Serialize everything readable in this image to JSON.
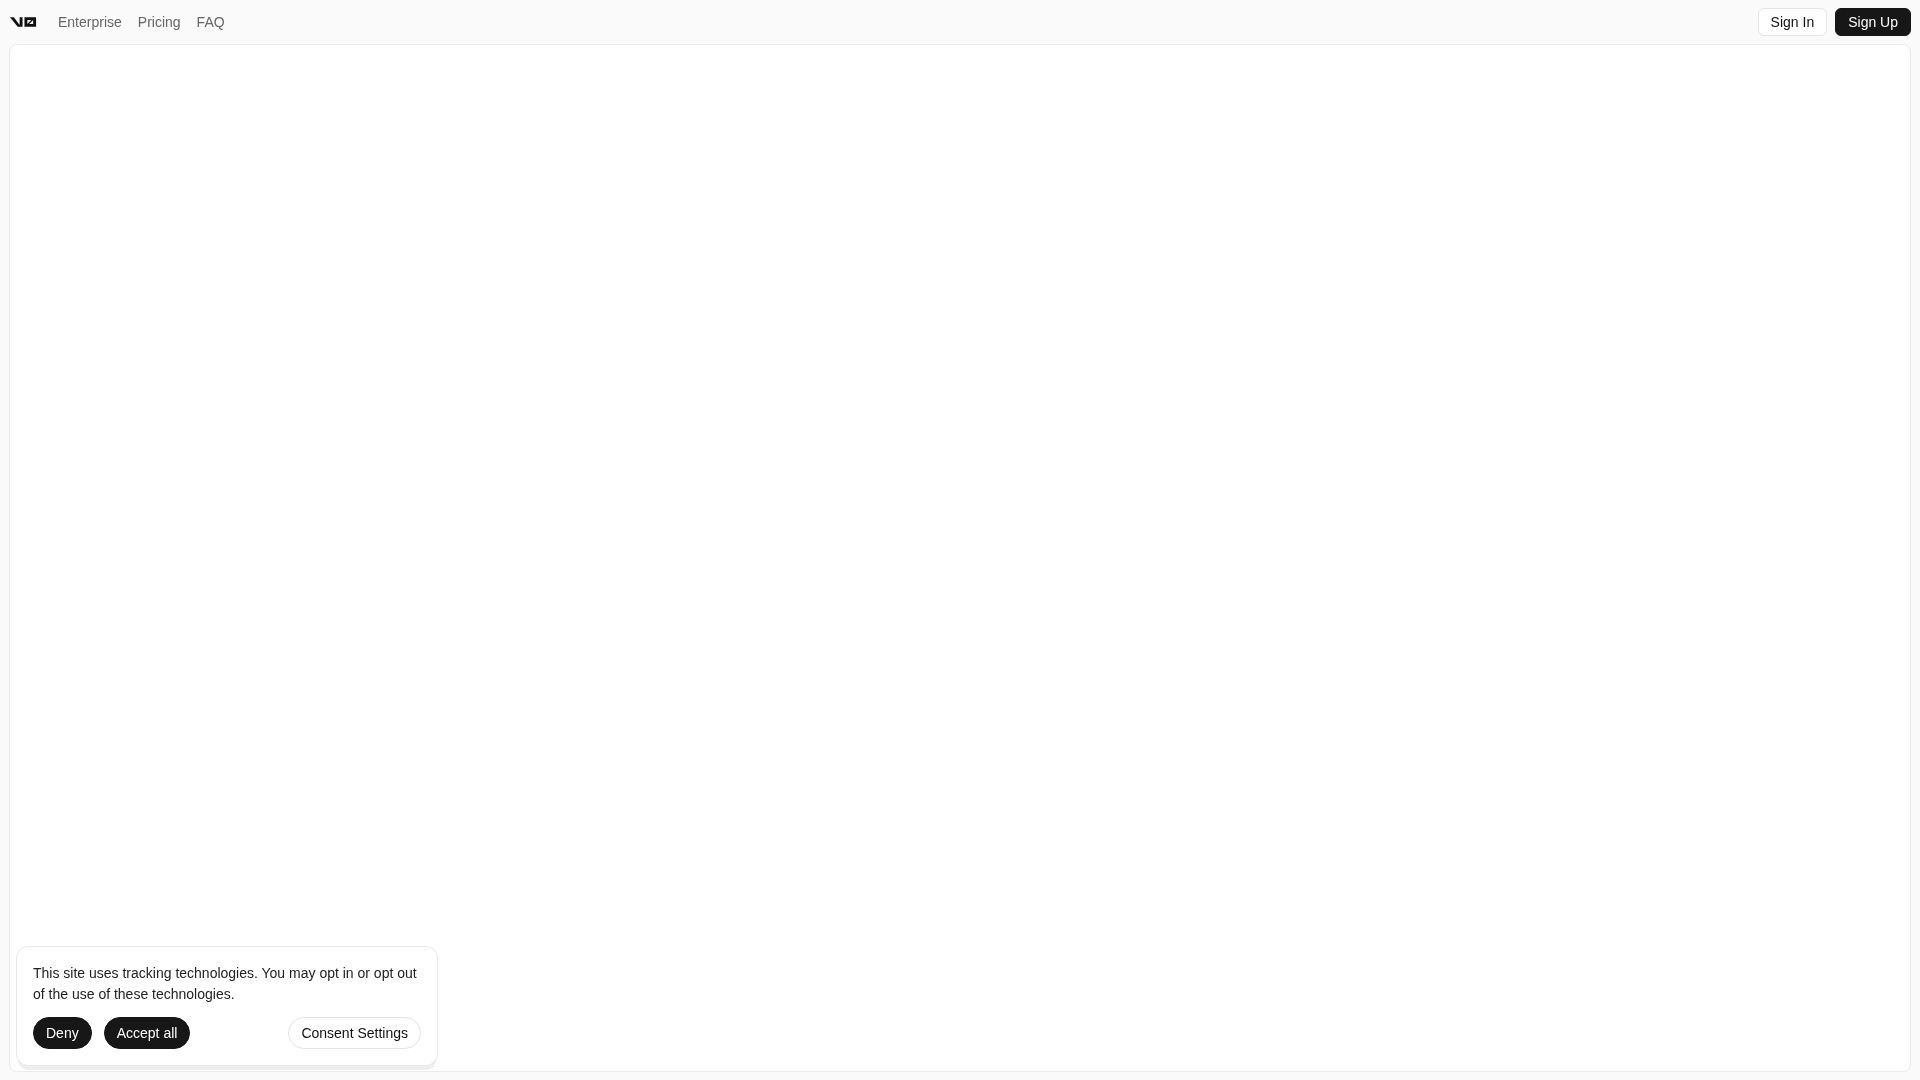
{
  "nav": {
    "links": [
      "Enterprise",
      "Pricing",
      "FAQ"
    ],
    "actions": [
      {
        "label": "Sign In",
        "kind": "outline"
      },
      {
        "label": "Sign Up",
        "kind": "solid"
      }
    ]
  },
  "cookie_banner": {
    "message": "This site uses tracking technologies. You may opt in or opt out of the use of these technologies.",
    "buttons": [
      {
        "label": "Deny",
        "kind": "solid"
      },
      {
        "label": "Accept all",
        "kind": "solid"
      },
      {
        "label": "Consent Settings",
        "kind": "outline"
      }
    ]
  }
}
